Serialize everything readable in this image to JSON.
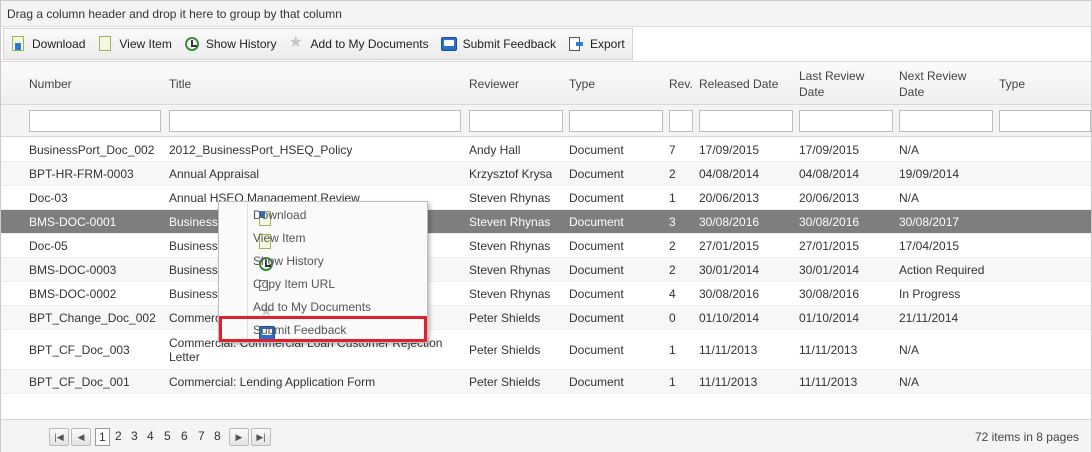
{
  "group_bar": {
    "text": "Drag a column header and drop it here to group by that column"
  },
  "toolbar": {
    "items": [
      {
        "label": "Download",
        "icon": "download-icon"
      },
      {
        "label": "View Item",
        "icon": "view-item-icon"
      },
      {
        "label": "Show History",
        "icon": "history-icon"
      },
      {
        "label": "Add to My Documents",
        "icon": "star-icon"
      },
      {
        "label": "Submit Feedback",
        "icon": "feedback-icon"
      },
      {
        "label": "Export",
        "icon": "export-icon"
      }
    ]
  },
  "grid": {
    "columns": [
      "Number",
      "Title",
      "Reviewer",
      "Type",
      "Rev.",
      "Released Date",
      "Last Review Date",
      "Next Review Date",
      "Type"
    ],
    "rows": [
      {
        "number": "BusinessPort_Doc_002",
        "title": "2012_BusinessPort_HSEQ_Policy",
        "reviewer": "Andy Hall",
        "type": "Document",
        "rev": "7",
        "released": "17/09/2015",
        "last_review": "17/09/2015",
        "next_review": "N/A"
      },
      {
        "number": "BPT-HR-FRM-0003",
        "title": "Annual Appraisal",
        "reviewer": "Krzysztof Krysa",
        "type": "Document",
        "rev": "2",
        "released": "04/08/2014",
        "last_review": "04/08/2014",
        "next_review": "19/09/2014"
      },
      {
        "number": "Doc-03",
        "title": "Annual HSEQ Management Review",
        "reviewer": "Steven Rhynas",
        "type": "Document",
        "rev": "1",
        "released": "20/06/2013",
        "last_review": "20/06/2013",
        "next_review": "N/A"
      },
      {
        "number": "BMS-DOC-0001",
        "title": "Business",
        "reviewer": "Steven Rhynas",
        "type": "Document",
        "rev": "3",
        "released": "30/08/2016",
        "last_review": "30/08/2016",
        "next_review": "30/08/2017"
      },
      {
        "number": "Doc-05",
        "title": "Business",
        "reviewer": "Steven Rhynas",
        "type": "Document",
        "rev": "2",
        "released": "27/01/2015",
        "last_review": "27/01/2015",
        "next_review": "17/04/2015"
      },
      {
        "number": "BMS-DOC-0003",
        "title": "Business",
        "reviewer": "Steven Rhynas",
        "type": "Document",
        "rev": "2",
        "released": "30/01/2014",
        "last_review": "30/01/2014",
        "next_review": "Action Required"
      },
      {
        "number": "BMS-DOC-0002",
        "title": "Business",
        "reviewer": "Steven Rhynas",
        "type": "Document",
        "rev": "4",
        "released": "30/08/2016",
        "last_review": "30/08/2016",
        "next_review": "In Progress"
      },
      {
        "number": "BPT_Change_Doc_002",
        "title": "Commerc",
        "reviewer": "Peter Shields",
        "type": "Document",
        "rev": "0",
        "released": "01/10/2014",
        "last_review": "01/10/2014",
        "next_review": "21/11/2014"
      },
      {
        "number": "BPT_CF_Doc_003",
        "title": "Commercial: Commercial Loan Customer Rejection Letter",
        "reviewer": "Peter Shields",
        "type": "Document",
        "rev": "1",
        "released": "11/11/2013",
        "last_review": "11/11/2013",
        "next_review": "N/A"
      },
      {
        "number": "BPT_CF_Doc_001",
        "title": "Commercial: Lending Application Form",
        "reviewer": "Peter Shields",
        "type": "Document",
        "rev": "1",
        "released": "11/11/2013",
        "last_review": "11/11/2013",
        "next_review": "N/A"
      }
    ],
    "selected_row_number": "BMS-DOC-0001"
  },
  "context_menu": {
    "items": [
      {
        "label": "Download",
        "icon": "download-icon"
      },
      {
        "label": "View Item",
        "icon": "view-item-icon"
      },
      {
        "label": "Show History",
        "icon": "history-icon"
      },
      {
        "label": "Copy Item URL",
        "icon": "copy-icon"
      },
      {
        "label": "Add to My Documents",
        "icon": "star-icon"
      },
      {
        "label": "Submit Feedback",
        "icon": "feedback-icon"
      }
    ],
    "highlighted": "Submit Feedback",
    "highlight_color": "#e0202a"
  },
  "pager": {
    "pages": [
      "1",
      "2",
      "3",
      "4",
      "5",
      "6",
      "7",
      "8"
    ],
    "current_page": "1",
    "info": "72 items in 8 pages"
  },
  "colors": {
    "selected_row_bg": "#7e7e7e",
    "highlight_border": "#e0202a"
  }
}
